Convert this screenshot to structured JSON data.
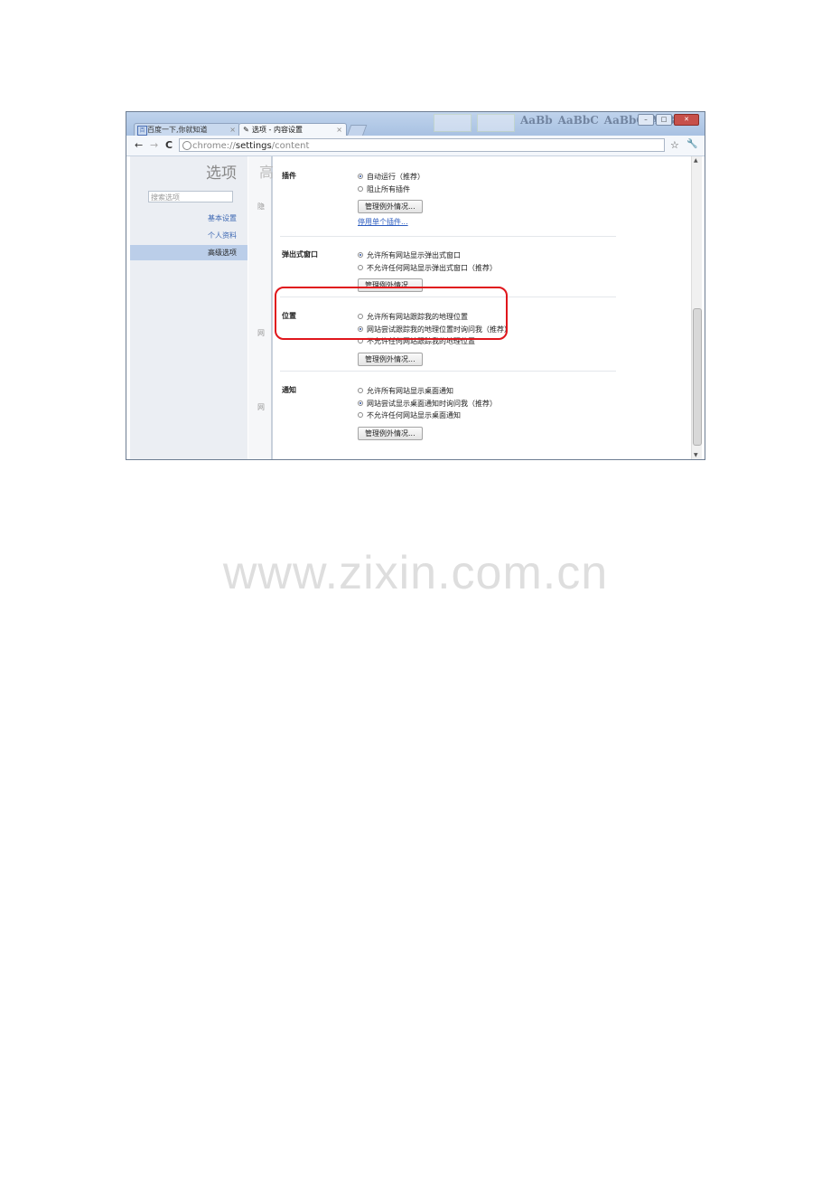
{
  "browser": {
    "tabs": [
      {
        "label": "百度一下,你就知道",
        "active": false,
        "icon": "baidu-icon"
      },
      {
        "label": "选项 - 内容设置",
        "active": true,
        "icon": "wrench-icon"
      }
    ],
    "address": {
      "scheme": "chrome://",
      "host": "settings",
      "path": "/content"
    },
    "nav": {
      "back": "←",
      "forward": "→",
      "reload": "C"
    },
    "star": "☆",
    "wrench": "🔧"
  },
  "sidebar": {
    "title": "选项",
    "search_placeholder": "搜索选项",
    "items": [
      {
        "label": "基本设置"
      },
      {
        "label": "个人资料"
      },
      {
        "label": "高级选项",
        "selected": true
      }
    ]
  },
  "underpage": {
    "heading": "高",
    "labels": [
      "隐",
      "网",
      "网"
    ]
  },
  "sections": {
    "plugins": {
      "title": "插件",
      "options": [
        {
          "label": "自动运行（推荐）",
          "checked": true
        },
        {
          "label": "阻止所有插件",
          "checked": false
        }
      ],
      "button": "管理例外情况...",
      "link": "停用单个插件..."
    },
    "popups": {
      "title": "弹出式窗口",
      "options": [
        {
          "label": "允许所有网站显示弹出式窗口",
          "checked": true
        },
        {
          "label": "不允许任何网站显示弹出式窗口（推荐）",
          "checked": false
        }
      ],
      "button": "管理例外情况..."
    },
    "location": {
      "title": "位置",
      "options": [
        {
          "label": "允许所有网站跟踪我的地理位置",
          "checked": false
        },
        {
          "label": "网站尝试跟踪我的地理位置时询问我（推荐）",
          "checked": true
        },
        {
          "label": "不允许任何网站跟踪我的地理位置",
          "checked": false
        }
      ],
      "button": "管理例外情况..."
    },
    "notifications": {
      "title": "通知",
      "options": [
        {
          "label": "允许所有网站显示桌面通知",
          "checked": false
        },
        {
          "label": "网站尝试显示桌面通知时询问我（推荐）",
          "checked": true
        },
        {
          "label": "不允许任何网站显示桌面通知",
          "checked": false
        }
      ],
      "button": "管理例外情况..."
    }
  },
  "watermark": "www.zixin.com.cn",
  "colors": {
    "highlight": "#e0161c",
    "link": "#2b5bbf",
    "selected_bg": "#bbcee9"
  }
}
